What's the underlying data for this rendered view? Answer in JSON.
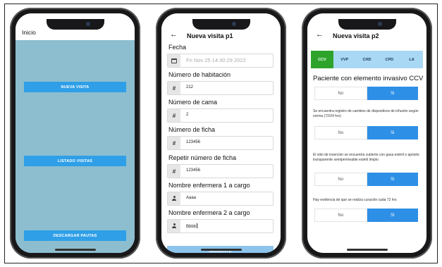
{
  "inicio": {
    "title": "Inicio",
    "buttons": [
      "NUEVA VISITA",
      "LISTADO VISITAS",
      "DESCARGAR PAUTAS"
    ]
  },
  "form1": {
    "title": "Nueva visita p1",
    "back_icon": "arrow-left-icon",
    "fields": [
      {
        "label": "Fecha",
        "value": "Fri Nov 25 14:30:29 2022",
        "icon": "calendar-icon"
      },
      {
        "label": "Número de habitación",
        "value": "212",
        "icon": "hash-icon"
      },
      {
        "label": "Número de cama",
        "value": "2",
        "icon": "hash-icon"
      },
      {
        "label": "Número de ficha",
        "value": "123456",
        "icon": "hash-icon"
      },
      {
        "label": "Repetir número de ficha",
        "value": "123456",
        "icon": "hash-icon"
      },
      {
        "label": "Nombre enfermera 1 a cargo",
        "value": "Aaaa",
        "icon": "person-icon"
      },
      {
        "label": "Nombre enfermera 2 a cargo",
        "value": "Bbbb",
        "icon": "person-icon"
      }
    ],
    "hash_glyph": "#",
    "submit": "SIGUIENTE"
  },
  "form2": {
    "title": "Nueva visita p2",
    "tabs": [
      "CCV",
      "VVP",
      "CHD",
      "CPD",
      "LA"
    ],
    "active_tab": "CCV",
    "section_title": "Paciente con elemento invasivo CCV",
    "questions": [
      "Se encuentra registro de cambios de dispositivos de infusión según norma (72/24 hrs)",
      "El sitio de inserción se encuentra cubierto con gasa estéril o apósito transparente semipermeable estéril limpio",
      "Hay evidencia de que se realiza curación cada 72 hrs"
    ],
    "no_label": "No",
    "yes_label": "Si"
  },
  "colors": {
    "primary_button": "#2f9fe8",
    "home_background": "#8cbecf",
    "active_tab": "#2ea32c",
    "tab_bar": "#a9d8f5",
    "submit_disabled": "#8cc4ec"
  }
}
